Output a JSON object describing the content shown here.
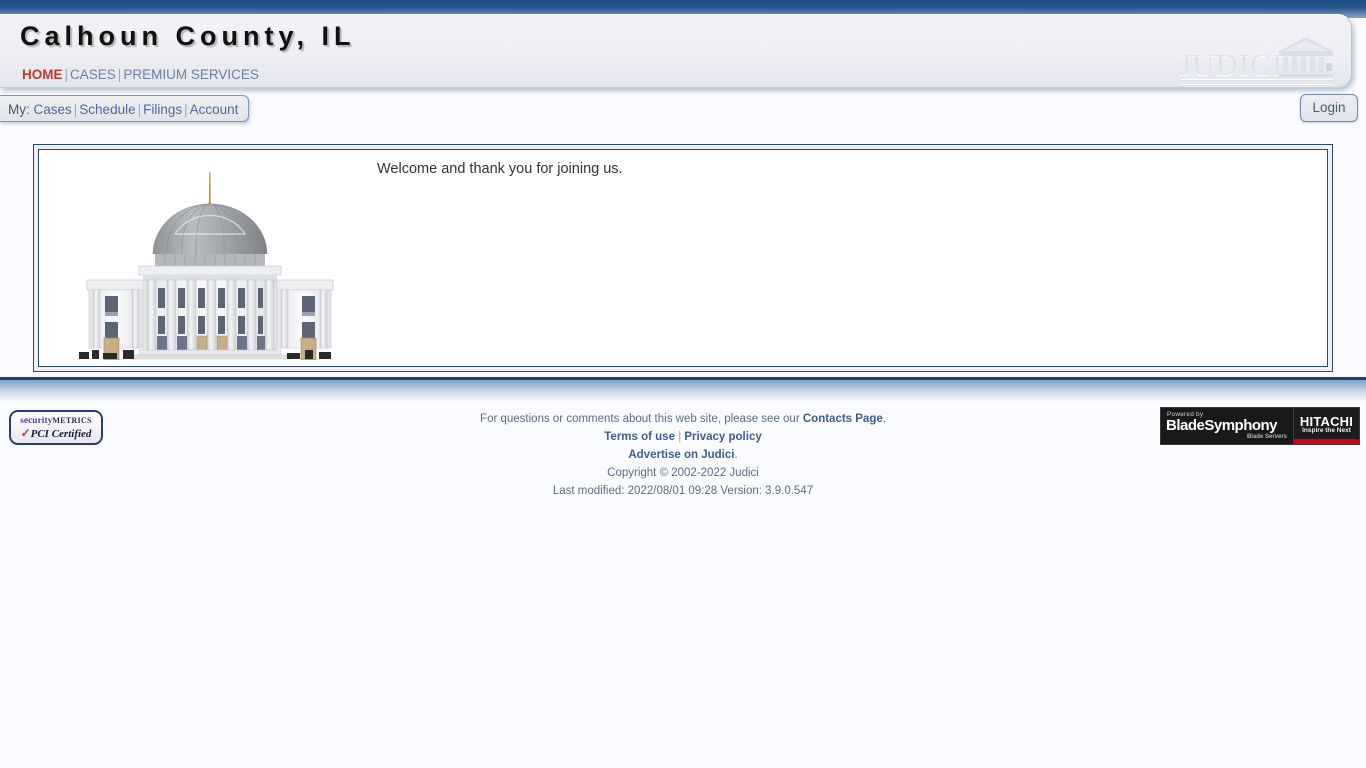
{
  "header": {
    "site_title": "Calhoun County, IL",
    "nav": [
      {
        "label": "HOME",
        "active": true
      },
      {
        "label": "CASES",
        "active": false
      },
      {
        "label": "PREMIUM SERVICES",
        "active": false
      }
    ],
    "logo_word": "JUDICI",
    "logo_icon": "courthouse-icon"
  },
  "subnav": {
    "my_label": "My:",
    "items": [
      {
        "label": "Cases"
      },
      {
        "label": "Schedule"
      },
      {
        "label": "Filings"
      },
      {
        "label": "Account"
      }
    ],
    "login_label": "Login"
  },
  "main": {
    "welcome_text": "Welcome and thank you for joining us.",
    "image_name": "courthouse-illustration"
  },
  "footer": {
    "line1_prefix": "For questions or comments about this web site, please see our ",
    "line1_link": "Contacts Page",
    "line1_suffix": ".",
    "terms_label": "Terms of use",
    "privacy_label": "Privacy policy",
    "advertise_label": "Advertise on Judici",
    "advertise_suffix": ".",
    "copyright": "Copyright © 2002-2022 Judici",
    "last_modified": "Last modified: 2022/08/01 09:28 Version: 3.9.0.547",
    "pci_badge": {
      "word_a": "security",
      "word_b": "METRICS",
      "check": "✓",
      "certified": "PCI Certified"
    },
    "blade_badge": {
      "powered_by": "Powered by",
      "product": "BladeSymphony",
      "subtitle": "Blade Servers",
      "brand": "HITACHI",
      "tagline": "Inspire the Next"
    }
  },
  "colors": {
    "navy": "#1b4a82",
    "accent_red": "#c0392b",
    "link_blue": "#3f5d91",
    "panel_bg": "#eeeef4",
    "page_bg": "#f9fbfe"
  }
}
